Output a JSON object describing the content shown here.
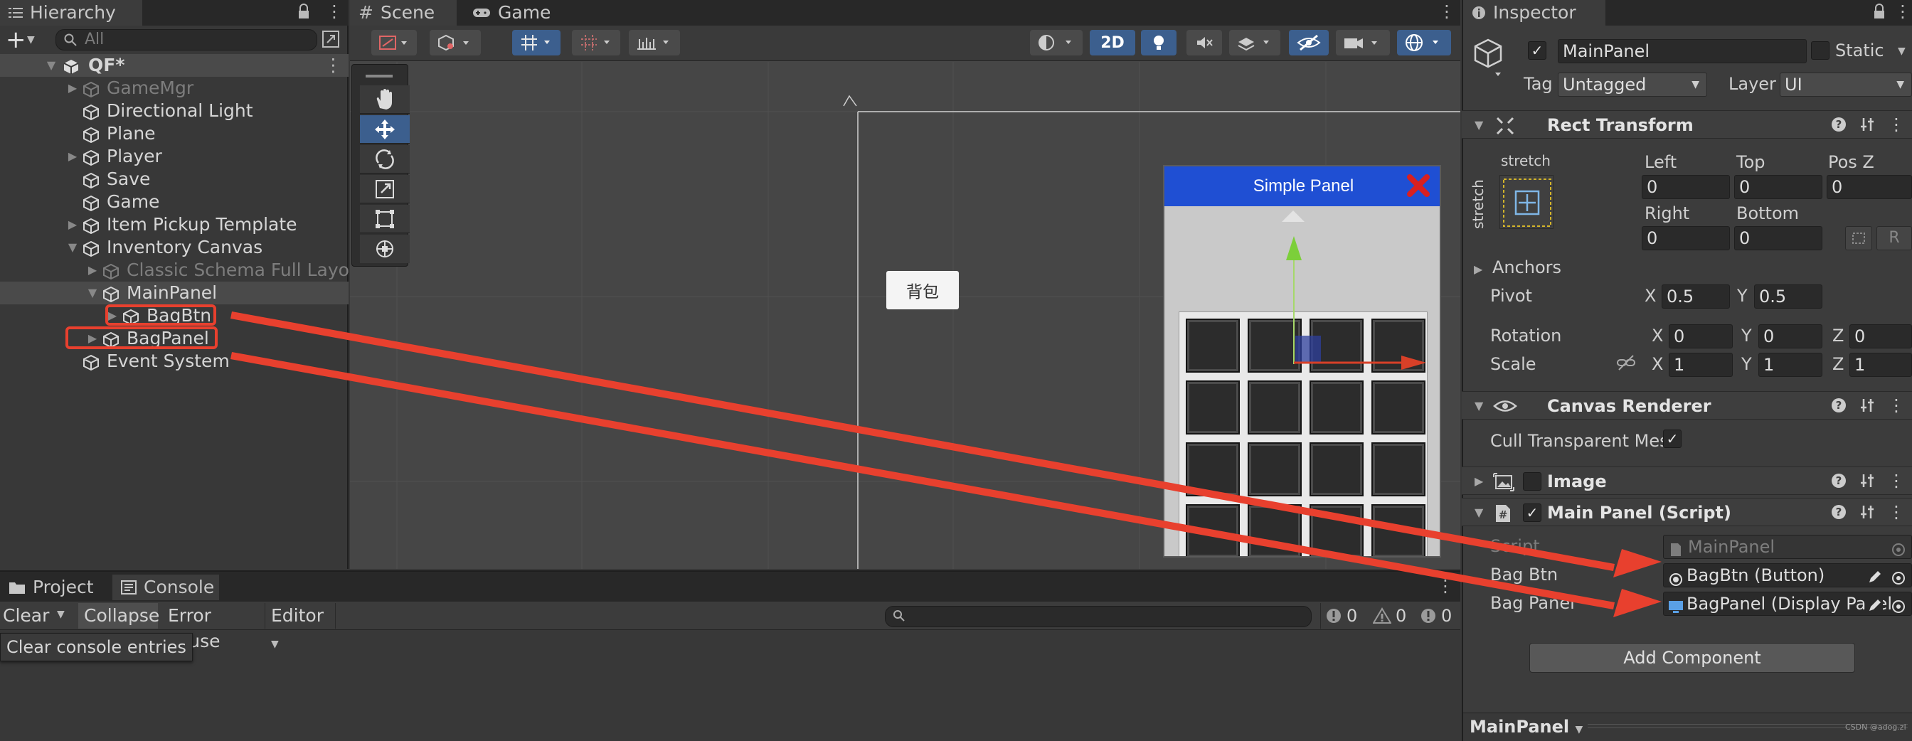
{
  "hierarchy": {
    "tab_label": "Hierarchy",
    "search_placeholder": "All",
    "scene_name": "QF*",
    "items": [
      {
        "label": "GameMgr"
      },
      {
        "label": "Directional Light"
      },
      {
        "label": "Plane"
      },
      {
        "label": "Player"
      },
      {
        "label": "Save"
      },
      {
        "label": "Game"
      },
      {
        "label": "Item Pickup Template"
      },
      {
        "label": "Inventory Canvas"
      },
      {
        "label": "Classic Schema Full Layout"
      },
      {
        "label": "MainPanel"
      },
      {
        "label": "BagBtn"
      },
      {
        "label": "BagPanel"
      },
      {
        "label": "Event System"
      }
    ]
  },
  "scene": {
    "tab_scene": "Scene",
    "tab_game": "Game",
    "toggle_2d": "2D",
    "button_label": "背包",
    "panel_title": "Simple Panel"
  },
  "console": {
    "tab_project": "Project",
    "tab_console": "Console",
    "clear": "Clear",
    "collapse": "Collapse",
    "error_pause": "Error Pause",
    "editor": "Editor",
    "tooltip": "Clear console entries",
    "count_log": "0",
    "count_warn": "0",
    "count_error": "0"
  },
  "inspector": {
    "tab_label": "Inspector",
    "object_name": "MainPanel",
    "static_label": "Static",
    "tag_label": "Tag",
    "tag_value": "Untagged",
    "layer_label": "Layer",
    "layer_value": "UI",
    "rect": {
      "title": "Rect Transform",
      "anchor_preset_top": "stretch",
      "anchor_preset_side": "stretch",
      "left_label": "Left",
      "left": "0",
      "top_label": "Top",
      "top": "0",
      "posz_label": "Pos Z",
      "posz": "0",
      "right_label": "Right",
      "right": "0",
      "bottom_label": "Bottom",
      "bottom": "0",
      "r_button": "R",
      "anchors_label": "Anchors",
      "pivot_label": "Pivot",
      "pivot_x": "0.5",
      "pivot_y": "0.5",
      "rotation_label": "Rotation",
      "rot_x": "0",
      "rot_y": "0",
      "rot_z": "0",
      "scale_label": "Scale",
      "scale_x": "1",
      "scale_y": "1",
      "scale_z": "1",
      "x": "X",
      "y": "Y",
      "z": "Z"
    },
    "canvas_renderer": {
      "title": "Canvas Renderer",
      "cull_label": "Cull Transparent Mes"
    },
    "image": {
      "title": "Image"
    },
    "script": {
      "title": "Main Panel (Script)",
      "script_label": "Script",
      "script_value": "MainPanel",
      "bagbtn_label": "Bag Btn",
      "bagbtn_value": "BagBtn (Button)",
      "bagpanel_label": "Bag Panel",
      "bagpanel_value": "BagPanel (Display Panel"
    },
    "add_component": "Add Component",
    "footer_label": "MainPanel",
    "watermark": "CSDN @adog.zl"
  },
  "colors": {
    "annotation_red": "#e8402e",
    "panel_header_blue": "#1f4fd3",
    "toolbar_blue": "#3c5f8e"
  }
}
